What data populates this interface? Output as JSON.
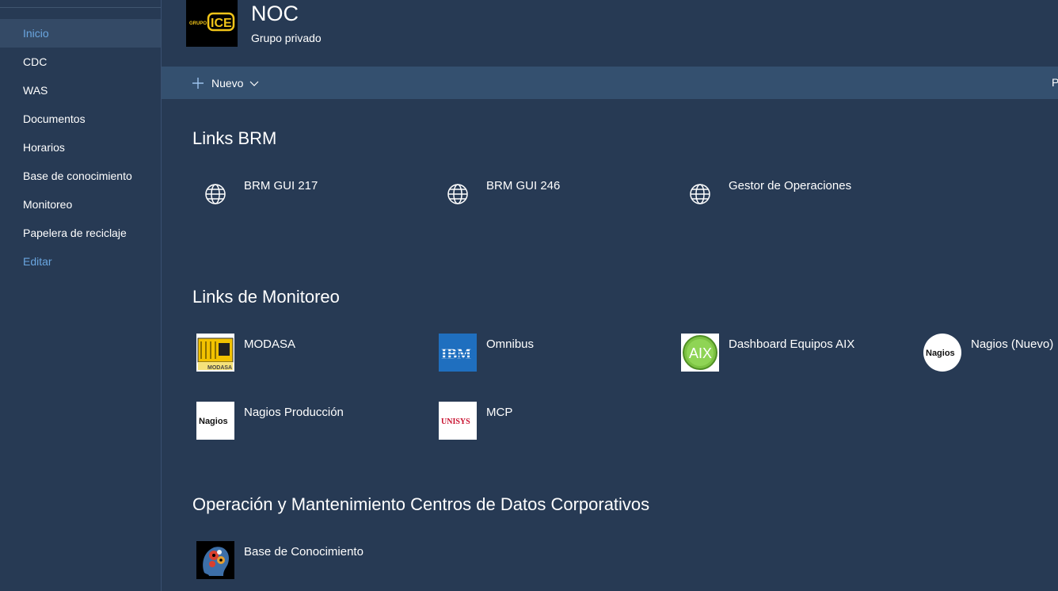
{
  "nav": {
    "items": [
      {
        "label": "Inicio"
      },
      {
        "label": "CDC"
      },
      {
        "label": "WAS"
      },
      {
        "label": "Documentos"
      },
      {
        "label": "Horarios"
      },
      {
        "label": "Base de conocimiento"
      },
      {
        "label": "Monitoreo"
      },
      {
        "label": "Papelera de reciclaje"
      }
    ],
    "edit_label": "Editar"
  },
  "header": {
    "logo_text": "GRUPO",
    "logo_brand": "ICE",
    "title": "NOC",
    "subtitle": "Grupo privado"
  },
  "commandbar": {
    "new_label": "Nuevo",
    "right_partial": "P"
  },
  "sections": {
    "brm": {
      "title": "Links BRM",
      "links": [
        {
          "label": "BRM GUI 217",
          "icon": "globe-icon"
        },
        {
          "label": "BRM GUI 246",
          "icon": "globe-icon"
        },
        {
          "label": "Gestor de Operaciones",
          "icon": "globe-icon"
        }
      ]
    },
    "monitoreo": {
      "title": "Links de Monitoreo",
      "links": [
        {
          "label": "MODASA",
          "thumb_text": "MODASA"
        },
        {
          "label": "Omnibus",
          "thumb_text": "IBM"
        },
        {
          "label": "Dashboard Equipos AIX",
          "thumb_text": "AIX"
        },
        {
          "label": "Nagios (Nuevo)",
          "thumb_text": "Nagios"
        },
        {
          "label": "Nagios Producción",
          "thumb_text": "Nagios"
        },
        {
          "label": "MCP",
          "thumb_text": "UNISYS"
        }
      ]
    },
    "operacion": {
      "title": "Operación y Mantenimiento Centros de Datos Corporativos",
      "links": [
        {
          "label": "Base de Conocimiento"
        }
      ]
    }
  },
  "colors": {
    "background": "#273a54",
    "commandbar": "#34506f",
    "accent": "#6aa6e0"
  }
}
